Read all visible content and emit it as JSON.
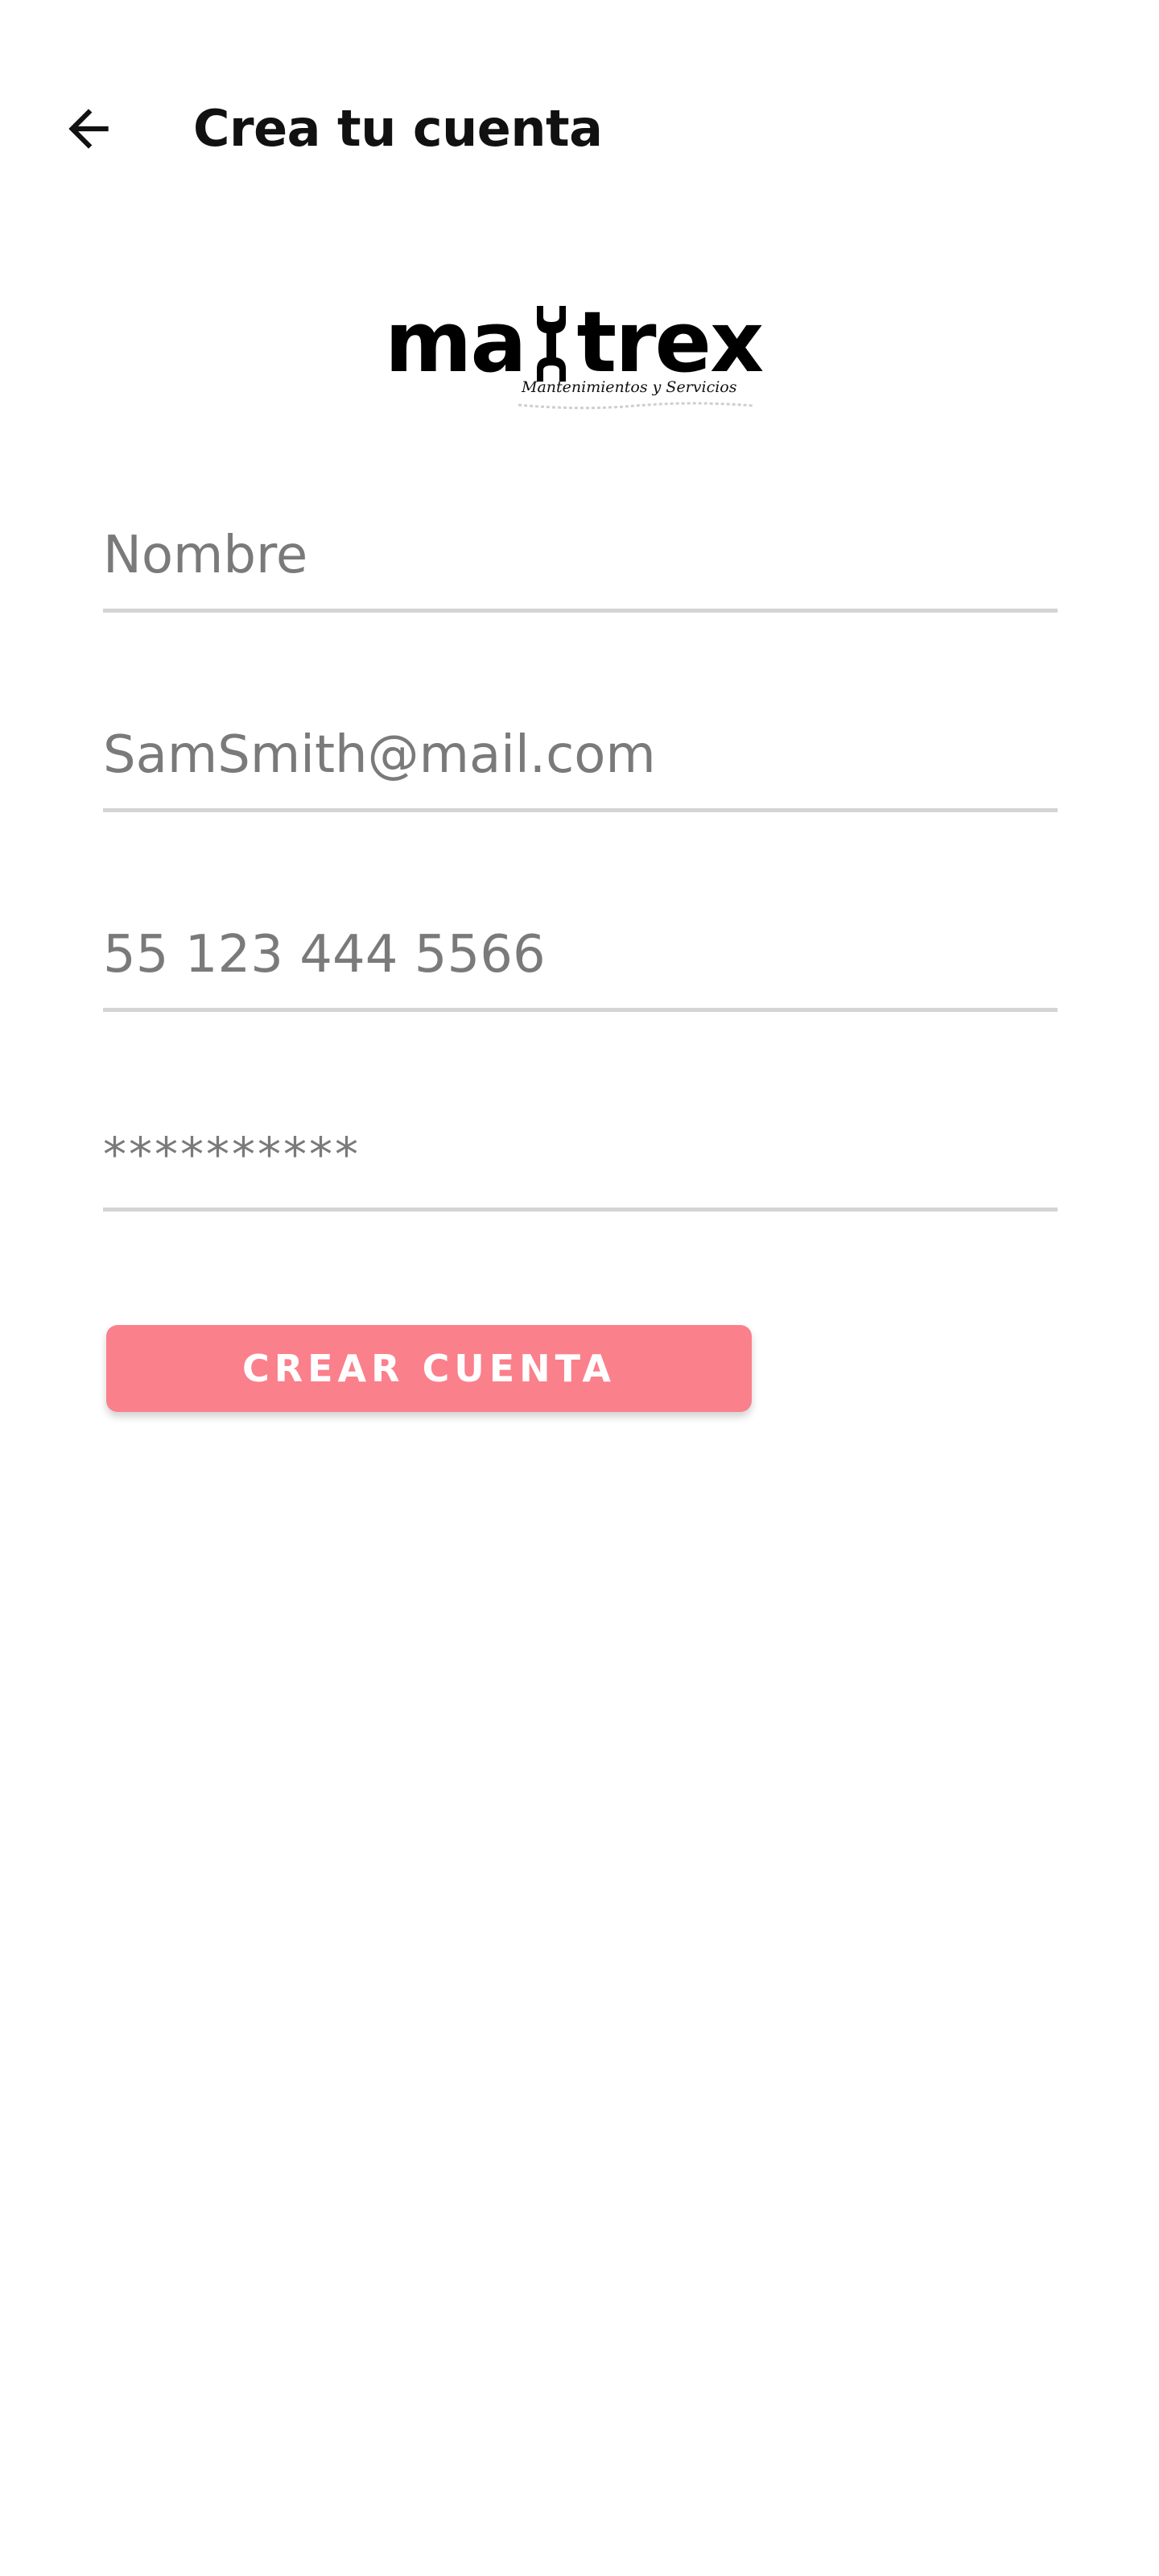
{
  "header": {
    "back_icon": "arrow-left-icon",
    "title": "Crea tu cuenta"
  },
  "logo": {
    "word_left": "ma",
    "word_right": "trex",
    "tagline": "Mantenimientos y Servicios",
    "wrench_icon": "wrench-icon"
  },
  "form": {
    "name_placeholder": "Nombre",
    "email_placeholder": "SamSmith@mail.com",
    "phone_placeholder": "55 123 444 5566",
    "password_placeholder": "**********",
    "submit_label": "CREAR CUENTA"
  },
  "colors": {
    "accent": "#fa808c",
    "text_primary": "#111111",
    "placeholder": "#7a7a7a",
    "divider": "#d4d4d4",
    "background": "#ffffff"
  }
}
